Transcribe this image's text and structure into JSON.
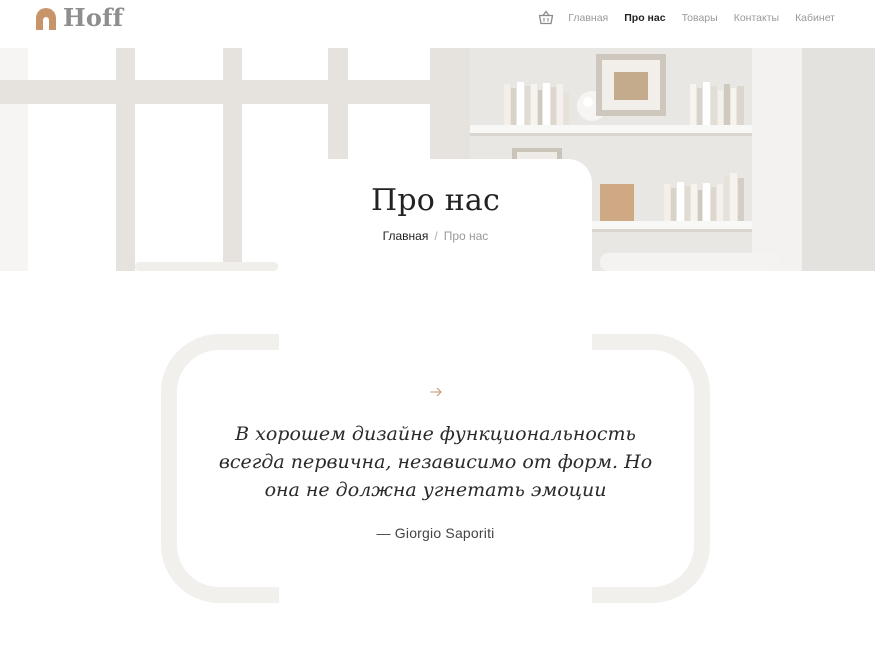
{
  "brand": {
    "name": "Hoff",
    "accent": "#c8956a",
    "logo_icon": "arch-icon"
  },
  "nav": {
    "cart_icon": "basket-icon",
    "items": [
      {
        "label": "Главная",
        "active": false
      },
      {
        "label": "Про нас",
        "active": true
      },
      {
        "label": "Товары",
        "active": false
      },
      {
        "label": "Контакты",
        "active": false
      },
      {
        "label": "Кабинет",
        "active": false
      }
    ]
  },
  "hero": {
    "title": "Про нас",
    "breadcrumb": {
      "home": "Главная",
      "separator": "/",
      "current": "Про нас"
    }
  },
  "quote": {
    "icon": "arrow-right-icon",
    "text": "В хорошем дизайне функциональность всегда первична, независимо от форм. Но она не должна угнетать эмоции",
    "author": "— Giorgio Saporiti"
  }
}
